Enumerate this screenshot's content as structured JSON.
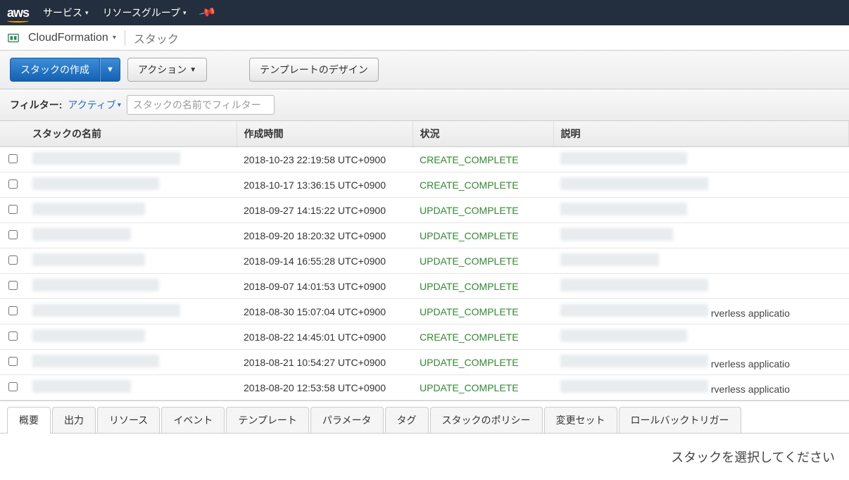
{
  "topnav": {
    "logo": "aws",
    "services": "サービス",
    "resource_groups": "リソースグループ"
  },
  "breadcrumb": {
    "service": "CloudFormation",
    "page": "スタック"
  },
  "toolbar": {
    "create_stack": "スタックの作成",
    "actions": "アクション",
    "design_template": "テンプレートのデザイン"
  },
  "filter": {
    "label": "フィルター:",
    "active": "アクティブ",
    "placeholder": "スタックの名前でフィルター"
  },
  "table": {
    "headers": {
      "name": "スタックの名前",
      "created": "作成時間",
      "status": "状況",
      "description": "説明"
    },
    "rows": [
      {
        "created": "2018-10-23 22:19:58 UTC+0900",
        "status": "CREATE_COMPLETE",
        "desc": ""
      },
      {
        "created": "2018-10-17 13:36:15 UTC+0900",
        "status": "CREATE_COMPLETE",
        "desc": ""
      },
      {
        "created": "2018-09-27 14:15:22 UTC+0900",
        "status": "UPDATE_COMPLETE",
        "desc": ""
      },
      {
        "created": "2018-09-20 18:20:32 UTC+0900",
        "status": "UPDATE_COMPLETE",
        "desc": ""
      },
      {
        "created": "2018-09-14 16:55:28 UTC+0900",
        "status": "UPDATE_COMPLETE",
        "desc": ""
      },
      {
        "created": "2018-09-07 14:01:53 UTC+0900",
        "status": "UPDATE_COMPLETE",
        "desc": ""
      },
      {
        "created": "2018-08-30 15:07:04 UTC+0900",
        "status": "UPDATE_COMPLETE",
        "desc": "rverless applicatio"
      },
      {
        "created": "2018-08-22 14:45:01 UTC+0900",
        "status": "CREATE_COMPLETE",
        "desc": ""
      },
      {
        "created": "2018-08-21 10:54:27 UTC+0900",
        "status": "UPDATE_COMPLETE",
        "desc": "rverless applicatio"
      },
      {
        "created": "2018-08-20 12:53:58 UTC+0900",
        "status": "UPDATE_COMPLETE",
        "desc": "rverless applicatio"
      }
    ]
  },
  "tabs": {
    "overview": "概要",
    "outputs": "出力",
    "resources": "リソース",
    "events": "イベント",
    "template": "テンプレート",
    "parameters": "パラメータ",
    "tags": "タグ",
    "policy": "スタックのポリシー",
    "changesets": "変更セット",
    "rollback": "ロールバックトリガー"
  },
  "detail": {
    "empty": "スタックを選択してください"
  }
}
